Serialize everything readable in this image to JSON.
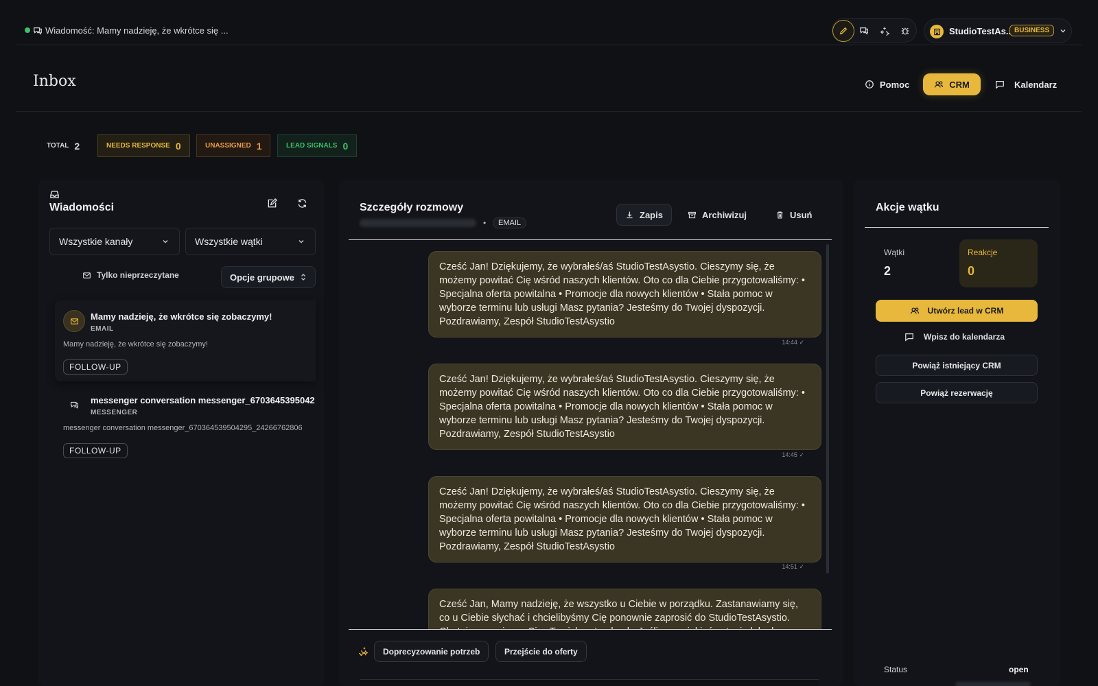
{
  "topbar": {
    "message": "Wiadomość: Mamy nadzieję, że wkrótce się ...",
    "account_name": "StudioTestAs...",
    "account_badge": "BUSINESS"
  },
  "header": {
    "title": "Inbox",
    "help_label": "Pomoc",
    "crm_label": "CRM",
    "calendar_label": "Kalendarz"
  },
  "stats": {
    "total_label": "TOTAL",
    "total": "2",
    "needs_label": "NEEDS RESPONSE",
    "needs": "0",
    "unassigned_label": "UNASSIGNED",
    "unassigned": "1",
    "lead_label": "LEAD SIGNALS",
    "lead": "0"
  },
  "messages_panel": {
    "title": "Wiadomości",
    "channel_filter": "Wszystkie kanały",
    "thread_filter": "Wszystkie wątki",
    "unread_only": "Tylko nieprzeczytane",
    "group_options": "Opcje grupowe",
    "threads": [
      {
        "title": "Mamy nadzieję, że wkrótce się zobaczymy!",
        "channel": "EMAIL",
        "preview": "Mamy nadzieję, że wkrótce się zobaczymy!",
        "tag": "FOLLOW-UP"
      },
      {
        "title": "messenger conversation messenger_6703645395042",
        "channel": "MESSENGER",
        "preview": "messenger conversation messenger_670364539504295_24266762806",
        "tag": "FOLLOW-UP"
      }
    ]
  },
  "conversation": {
    "title": "Szczegóły rozmowy",
    "channel_chip": "EMAIL",
    "save_label": "Zapis",
    "archive_label": "Archiwizuj",
    "delete_label": "Usuń",
    "messages": [
      {
        "text": "Cześć Jan! Dziękujemy, że wybrałeś/aś StudioTestAsystio. Cieszymy się, że możemy powitać Cię wśród naszych klientów. Oto co dla Ciebie przygotowaliśmy: • Specjalna oferta powitalna • Promocje dla nowych klientów • Stała pomoc w wyborze terminu lub usługi Masz pytania? Jesteśmy do Twojej dyspozycji. Pozdrawiamy, Zespół StudioTestAsystio",
        "time": "14:44"
      },
      {
        "text": "Cześć Jan! Dziękujemy, że wybrałeś/aś StudioTestAsystio. Cieszymy się, że możemy powitać Cię wśród naszych klientów. Oto co dla Ciebie przygotowaliśmy: • Specjalna oferta powitalna • Promocje dla nowych klientów • Stała pomoc w wyborze terminu lub usługi Masz pytania? Jesteśmy do Twojej dyspozycji. Pozdrawiamy, Zespół StudioTestAsystio",
        "time": "14:45"
      },
      {
        "text": "Cześć Jan! Dziękujemy, że wybrałeś/aś StudioTestAsystio. Cieszymy się, że możemy powitać Cię wśród naszych klientów. Oto co dla Ciebie przygotowaliśmy: • Specjalna oferta powitalna • Promocje dla nowych klientów • Stała pomoc w wyborze terminu lub usługi Masz pytania? Jesteśmy do Twojej dyspozycji. Pozdrawiamy, Zespół StudioTestAsystio",
        "time": "14:51"
      },
      {
        "text": "Cześć Jan, Mamy nadzieję, że wszystko u Ciebie w porządku. Zastanawiamy się, co u Ciebie słychać i chcielibyśmy Cię ponownie zaprosić do StudioTestAsystio. Chętnie pomożemy Ci w Twoich potrzebach. Jeśli masz jakieś pytania lub chcesz",
        "time": ""
      }
    ],
    "chips": [
      "Doprecyzowanie potrzeb",
      "Przejście do oferty"
    ]
  },
  "actions_panel": {
    "title": "Akcje wątku",
    "threads_label": "Wątki",
    "threads_value": "2",
    "reactions_label": "Reakcje",
    "reactions_value": "0",
    "create_lead": "Utwórz lead w CRM",
    "add_calendar": "Wpisz do kalendarza",
    "link_crm": "Powiąż istniejący CRM",
    "link_booking": "Powiąż rezerwację",
    "status_label": "Status",
    "status_value": "open"
  },
  "colors": {
    "accent": "#e7b83b",
    "bubble": "#3b3623",
    "success": "#3fbf6a",
    "warning": "#e89a4a"
  }
}
